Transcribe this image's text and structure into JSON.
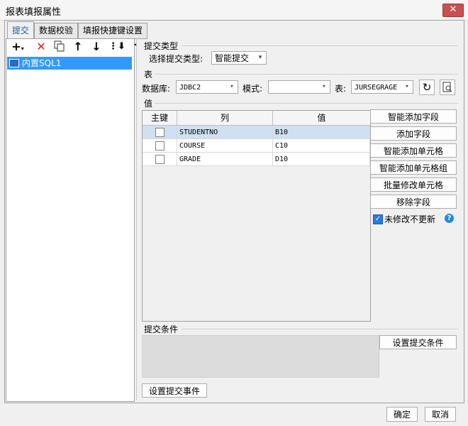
{
  "window": {
    "title": "报表填报属性",
    "close": "✕"
  },
  "tabs": [
    "提交",
    "数据校验",
    "填报快捷键设置"
  ],
  "tree": {
    "items": [
      "内置SQL1"
    ]
  },
  "submit_type": {
    "section": "提交类型",
    "label": "选择提交类型:",
    "value": "智能提交"
  },
  "table_section": {
    "section": "表",
    "db_label": "数据库:",
    "db_value": "JDBC2",
    "schema_label": "模式:",
    "schema_value": "",
    "table_label": "表:",
    "table_value": "JURSEGRAGE"
  },
  "values": {
    "section": "值",
    "columns": [
      "主键",
      "列",
      "值"
    ],
    "rows": [
      {
        "col": "STUDENTNO",
        "val": "B10",
        "checked": false
      },
      {
        "col": "COURSE",
        "val": "C10",
        "checked": false
      },
      {
        "col": "GRADE",
        "val": "D10",
        "checked": false
      }
    ]
  },
  "side_buttons": [
    "智能添加字段",
    "添加字段",
    "智能添加单元格",
    "智能添加单元格组",
    "批量修改单元格",
    "移除字段"
  ],
  "no_update": {
    "label": "未修改不更新",
    "checked": true,
    "help": "?"
  },
  "condition": {
    "section": "提交条件",
    "button": "设置提交条件"
  },
  "event_button": "设置提交事件",
  "footer": {
    "ok": "确定",
    "cancel": "取消"
  }
}
